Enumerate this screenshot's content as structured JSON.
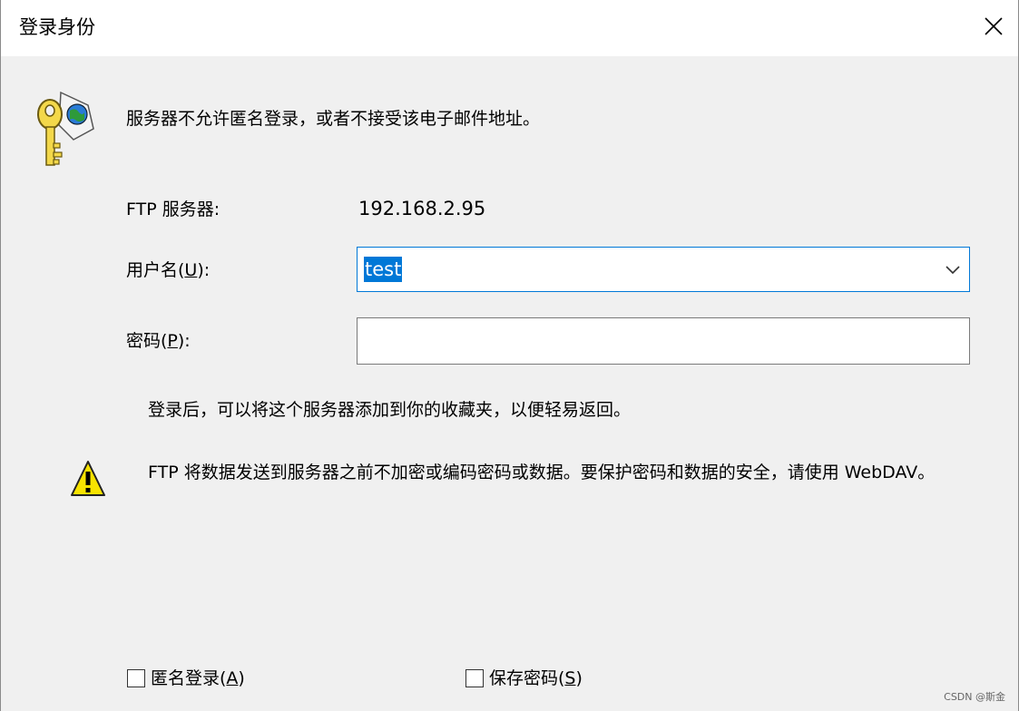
{
  "window": {
    "title": "登录身份",
    "close_symbol": "✕"
  },
  "message": "服务器不允许匿名登录，或者不接受该电子邮件地址。",
  "server": {
    "label": "FTP 服务器:",
    "value": "192.168.2.95"
  },
  "username": {
    "label_prefix": "用户名(",
    "accel": "U",
    "label_suffix": "):",
    "value": "test"
  },
  "password": {
    "label_prefix": "密码(",
    "accel": "P",
    "label_suffix": "):",
    "value": ""
  },
  "info": "登录后，可以将这个服务器添加到你的收藏夹，以便轻易返回。",
  "warning": {
    "text": "FTP 将数据发送到服务器之前不加密或编码密码或数据。要保护密码和数据的安全，请使用 WebDAV。"
  },
  "checkboxes": {
    "anonymous": {
      "label_prefix": "匿名登录(",
      "accel": "A",
      "label_suffix": ")",
      "checked": false
    },
    "save_password": {
      "label_prefix": "保存密码(",
      "accel": "S",
      "label_suffix": ")",
      "checked": false
    }
  },
  "watermark": "CSDN @斯金",
  "icons": {
    "key": "key-globe-icon",
    "warning": "warning-icon",
    "dropdown": "chevron-down-icon",
    "close": "close-icon"
  }
}
